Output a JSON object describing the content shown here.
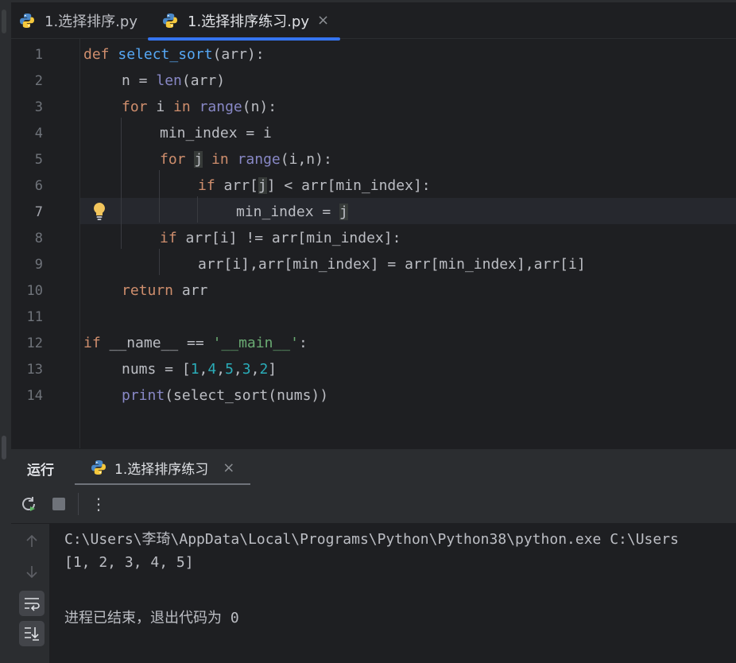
{
  "editor_tabs": [
    {
      "label": "1.选择排序.py",
      "active": false
    },
    {
      "label": "1.选择排序练习.py",
      "active": true,
      "close": "×"
    }
  ],
  "line_numbers": [
    "1",
    "2",
    "3",
    "4",
    "5",
    "6",
    "7",
    "8",
    "9",
    "10",
    "11",
    "12",
    "13",
    "14"
  ],
  "current_line": "7",
  "code": {
    "l1": {
      "k1": "def",
      "fn": "select_sort",
      "rest": "(arr):"
    },
    "l2": {
      "a": "n = ",
      "b": "len",
      "c": "(arr)"
    },
    "l3": {
      "k1": "for",
      "a": " i ",
      "k2": "in",
      "sp": " ",
      "b": "range",
      "c": "(n):"
    },
    "l4": {
      "a": "min_index = i"
    },
    "l5": {
      "k1": "for",
      "sp1": " ",
      "j": "j",
      "sp2": " ",
      "k2": "in",
      "sp3": " ",
      "b": "range",
      "c": "(i,n):"
    },
    "l6": {
      "k1": "if",
      "a": " arr[",
      "j": "j",
      "c": "] < arr[min_index]:"
    },
    "l7": {
      "a": "min_index = ",
      "j": "j"
    },
    "l8": {
      "k1": "if",
      "a": " arr[i] != arr[min_index]:"
    },
    "l9": {
      "a": "arr[i],arr[min_index] = arr[min_index],arr[i]"
    },
    "l10": {
      "k1": "return",
      "a": " arr"
    },
    "l12": {
      "k1": "if",
      "a": " __name__ == ",
      "s": "'__main__'",
      "c": ":"
    },
    "l13": {
      "a": "nums = [",
      "n1": "1",
      "c1": ",",
      "n2": "4",
      "c2": ",",
      "n3": "5",
      "c3": ",",
      "n4": "3",
      "c4": ",",
      "n5": "2",
      "e": "]"
    },
    "l14": {
      "b": "print",
      "a": "(select_sort(nums))"
    }
  },
  "run_panel": {
    "title": "运行",
    "tab_label": "1.选择排序练习",
    "close": "×",
    "more": "⋮",
    "console": [
      "C:\\Users\\李琦\\AppData\\Local\\Programs\\Python\\Python38\\python.exe C:\\Users",
      "[1, 2, 3, 4, 5]",
      "",
      "进程已结束，退出代码为 0"
    ]
  },
  "colors": {
    "keyword": "#cf8e6d",
    "function": "#56a8f5",
    "builtin": "#8888c6",
    "number": "#2aacb8",
    "string": "#6aab73",
    "accent": "#3574f0"
  }
}
